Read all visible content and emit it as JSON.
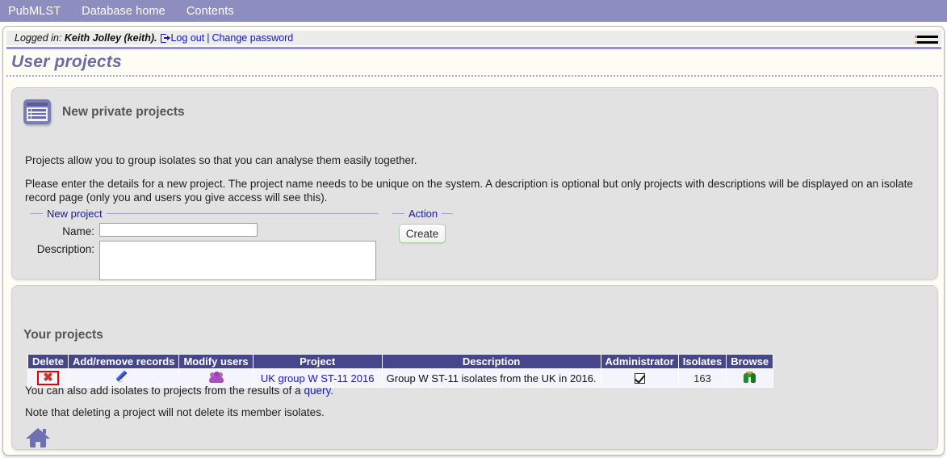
{
  "topnav": {
    "items": [
      {
        "label": "PubMLST",
        "name": "nav-pubmlst"
      },
      {
        "label": "Database home",
        "name": "nav-database-home"
      },
      {
        "label": "Contents",
        "name": "nav-contents"
      }
    ]
  },
  "loginbar": {
    "prefix": "Logged in:",
    "user": "Keith Jolley (keith).",
    "logout_label": "Log out",
    "separator": "|",
    "change_password_label": "Change password"
  },
  "header": {
    "title": "User projects",
    "menu_icon": "hamburger-icon"
  },
  "new_projects": {
    "icon": "list-icon",
    "heading": "New private projects",
    "paragraph_1": "Projects allow you to group isolates so that you can analyse them easily together.",
    "paragraph_2": "Please enter the details for a new project. The project name needs to be unique on the system. A description is optional but only projects with descriptions will be displayed on an isolate record page (only you and users you give access will see this).",
    "fieldset_new_legend": "New project",
    "fieldset_action_legend": "Action",
    "name_label": "Name:",
    "name_value": "",
    "name_placeholder": "",
    "description_label": "Description:",
    "description_value": "",
    "description_placeholder": "",
    "create_label": "Create"
  },
  "your_projects": {
    "heading": "Your projects",
    "columns": [
      "Delete",
      "Add/remove records",
      "Modify users",
      "Project",
      "Description",
      "Administrator",
      "Isolates",
      "Browse"
    ],
    "rows": [
      {
        "delete_icon": "cross-icon",
        "add_remove_icon": "pencil-icon",
        "modify_users_icon": "users-icon",
        "project": "UK group W ST-11 2016",
        "description": "Group W ST-11 isolates from the UK in 2016.",
        "administrator": true,
        "isolates": "163",
        "browse_icon": "binoculars-icon"
      }
    ],
    "note_1_before": "You can also add isolates to projects from the results of a ",
    "note_1_link": "query",
    "note_1_after": ".",
    "note_2": "Note that deleting a project will not delete its member isolates.",
    "home_icon": "home-icon"
  },
  "colors": {
    "nav_background": "#8d8dc0",
    "title_text": "#6c6ca0",
    "panel_background": "#e2e2e2",
    "table_header": "#46468c",
    "link": "#1818bb",
    "highlight_box": "#e40000",
    "create_border": "#a8d2a0"
  }
}
